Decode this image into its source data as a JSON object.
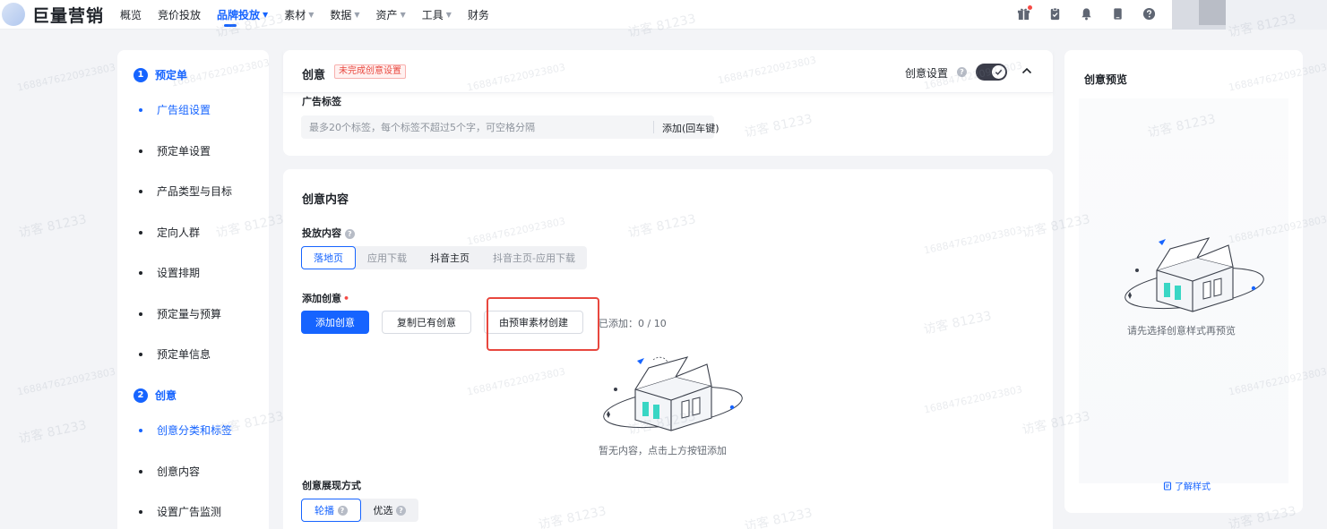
{
  "brand": {
    "logo_text": "巨量营销"
  },
  "nav": {
    "items": [
      {
        "label": "概览",
        "caret": ""
      },
      {
        "label": "竞价投放",
        "caret": ""
      },
      {
        "label": "品牌投放",
        "caret": "▼"
      },
      {
        "label": "素材",
        "caret": "▼"
      },
      {
        "label": "数据",
        "caret": "▼"
      },
      {
        "label": "资产",
        "caret": "▼"
      },
      {
        "label": "工具",
        "caret": "▼"
      },
      {
        "label": "财务",
        "caret": ""
      }
    ],
    "active_index": 2
  },
  "top_icons": [
    "gift-icon",
    "clipboard-icon",
    "bell-icon",
    "tablet-icon",
    "help-icon"
  ],
  "sidebar": {
    "step1": {
      "num": "1",
      "label": "预定单"
    },
    "step1_items": [
      "广告组设置",
      "预定单设置",
      "产品类型与目标",
      "定向人群",
      "设置排期",
      "预定量与预算",
      "预定单信息"
    ],
    "step2": {
      "num": "2",
      "label": "创意"
    },
    "step2_items": [
      "创意分类和标签",
      "创意内容",
      "设置广告监测"
    ]
  },
  "creative_card": {
    "title": "创意",
    "badge": "未完成创意设置",
    "setting_label": "创意设置",
    "help": "?",
    "tag_label": "广告标签",
    "tag_placeholder": "最多20个标签，每个标签不超过5个字，可空格分隔",
    "tag_add": "添加(回车键)"
  },
  "content_card": {
    "title": "创意内容",
    "delivery_label": "投放内容",
    "delivery_options": [
      "落地页",
      "应用下载",
      "抖音主页",
      "抖音主页-应用下载"
    ],
    "add_label": "添加创意",
    "required_mark": "•",
    "add_button": "添加创意",
    "copy_button": "复制已有创意",
    "preaudit_button": "由预审素材创建",
    "added_text": "已添加：0 / 10",
    "empty_text": "暂无内容，点击上方按钮添加",
    "display_label": "创意展现方式",
    "display_options": [
      "轮播",
      "优选"
    ]
  },
  "preview": {
    "title": "创意预览",
    "hint": "请先选择创意样式再预览",
    "link": "了解样式"
  },
  "watermark": {
    "id": "1688476220923803",
    "visitor": "访客 81233"
  },
  "colors": {
    "accent": "#1664ff",
    "danger": "#e8473e"
  }
}
